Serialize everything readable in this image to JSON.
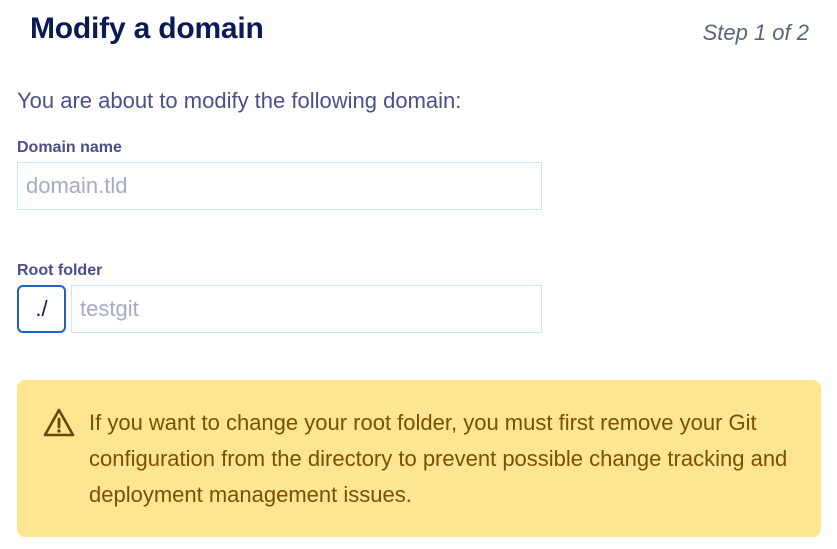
{
  "header": {
    "title": "Modify a domain",
    "step": "Step 1 of 2"
  },
  "form": {
    "intro": "You are about to modify the following domain:",
    "domain_label": "Domain name",
    "domain_value": "domain.tld",
    "root_label": "Root folder",
    "root_prefix": "./",
    "root_value": "testgit"
  },
  "warning": {
    "icon": "warning-triangle-icon",
    "text": "If you want to change your root folder, you must first remove your Git configuration from the directory to prevent possible change tracking and deployment management issues."
  },
  "colors": {
    "title": "#0b1a55",
    "accent_border": "#1f62c7",
    "warning_bg": "#fde68f",
    "warning_text": "#7a4f06"
  }
}
